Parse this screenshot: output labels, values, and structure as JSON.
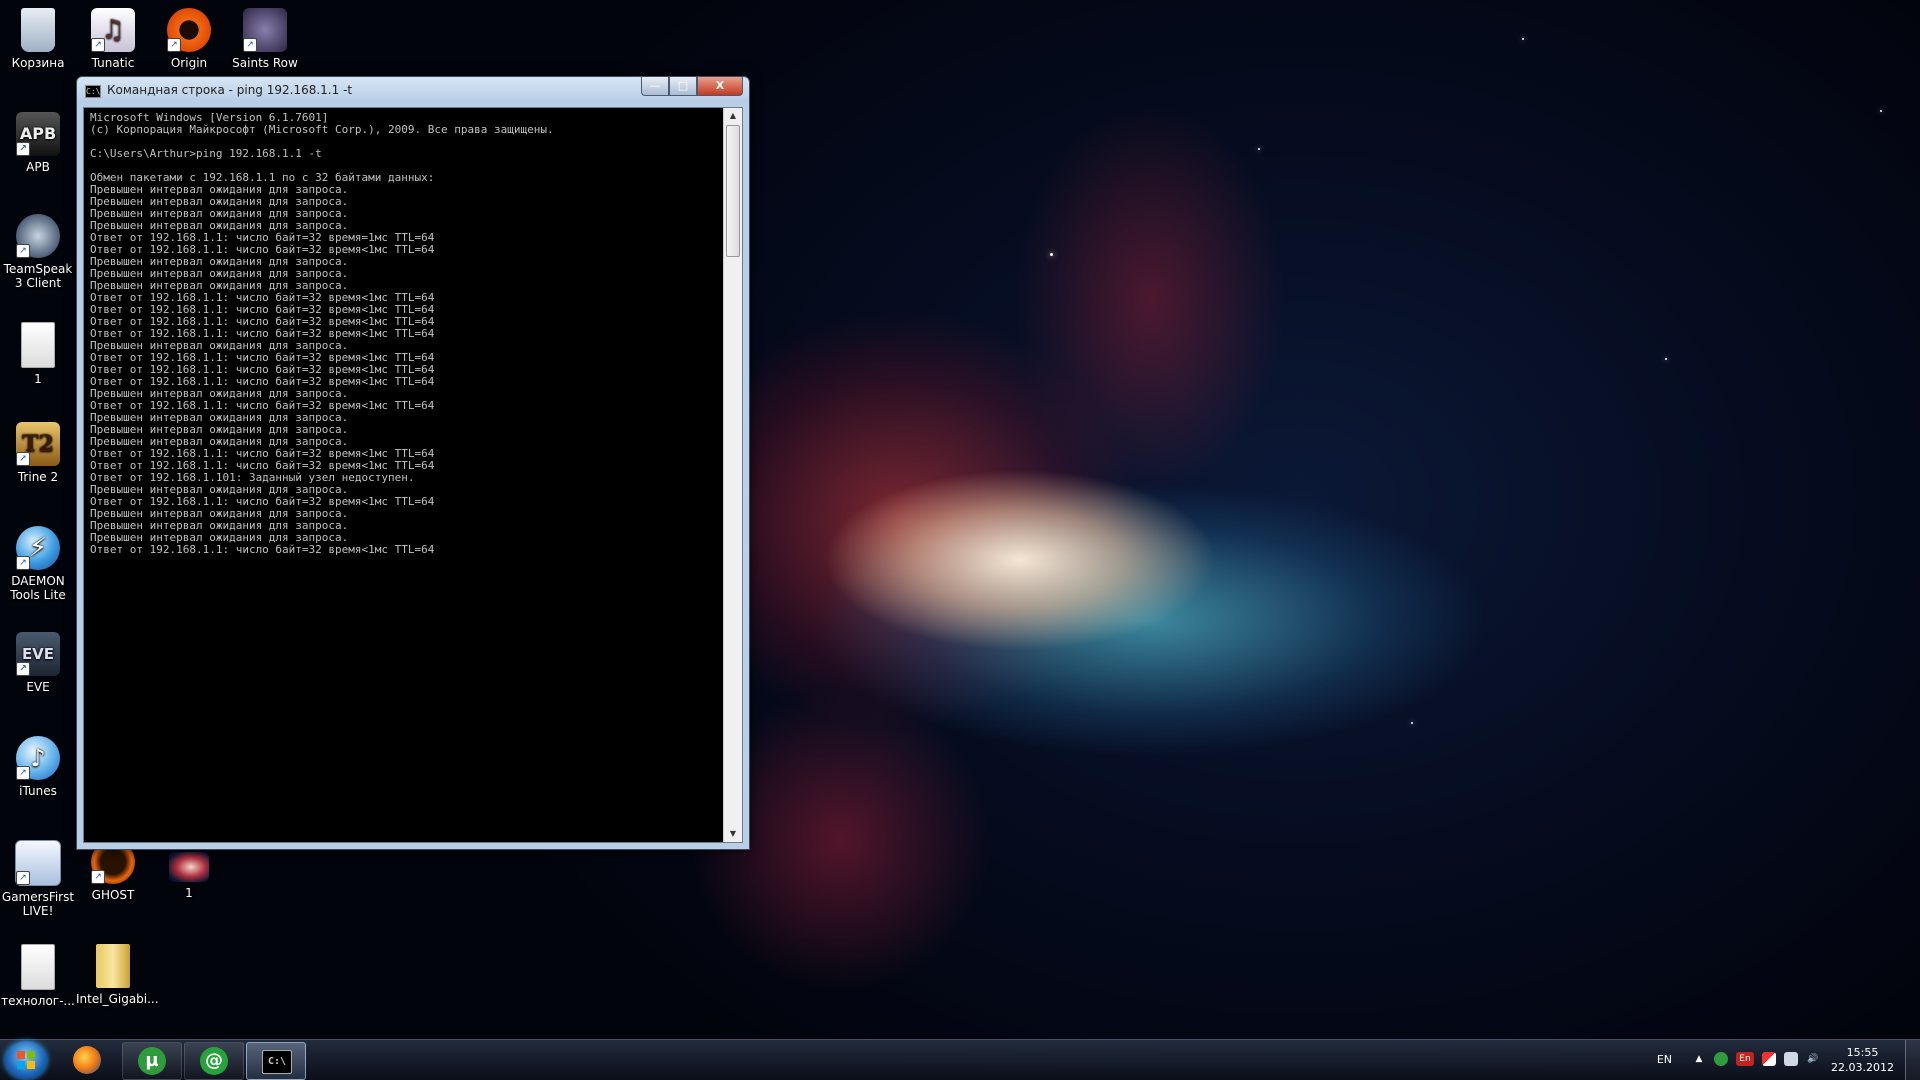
{
  "desktop": {
    "icons": [
      {
        "label": "Корзина",
        "icon": "recycle-bin-icon"
      },
      {
        "label": "Tunatic",
        "icon": "tunatic-icon"
      },
      {
        "label": "Origin",
        "icon": "origin-icon"
      },
      {
        "label": "Saints Row",
        "icon": "saints-row-icon"
      },
      {
        "label": "APB",
        "icon": "apb-icon"
      },
      {
        "label": "TeamSpeak 3 Client",
        "icon": "teamspeak-icon"
      },
      {
        "label": "1",
        "icon": "text-file-icon"
      },
      {
        "label": "Trine 2",
        "icon": "trine-icon"
      },
      {
        "label": "DAEMON Tools Lite",
        "icon": "daemon-tools-icon"
      },
      {
        "label": "EVE",
        "icon": "eve-icon"
      },
      {
        "label": "iTunes",
        "icon": "itunes-icon"
      },
      {
        "label": "GamersFirst LIVE!",
        "icon": "gamersfirst-icon"
      },
      {
        "label": "GHOST",
        "icon": "ghost-icon"
      },
      {
        "label": "1",
        "icon": "image-file-icon"
      },
      {
        "label": "технолог-...",
        "icon": "text-file-icon"
      },
      {
        "label": "Intel_Gigabi...",
        "icon": "zip-folder-icon"
      }
    ]
  },
  "window": {
    "title": "Командная строка - ping  192.168.1.1 -t",
    "controls": {
      "minimize": "—",
      "maximize": "□",
      "close": "X"
    },
    "console_lines": [
      "Microsoft Windows [Version 6.1.7601]",
      "(c) Корпорация Майкрософт (Microsoft Corp.), 2009. Все права защищены.",
      "",
      "C:\\Users\\Arthur>ping 192.168.1.1 -t",
      "",
      "Обмен пакетами с 192.168.1.1 по с 32 байтами данных:",
      "Превышен интервал ожидания для запроса.",
      "Превышен интервал ожидания для запроса.",
      "Превышен интервал ожидания для запроса.",
      "Превышен интервал ожидания для запроса.",
      "Ответ от 192.168.1.1: число байт=32 время=1мс TTL=64",
      "Ответ от 192.168.1.1: число байт=32 время<1мс TTL=64",
      "Превышен интервал ожидания для запроса.",
      "Превышен интервал ожидания для запроса.",
      "Превышен интервал ожидания для запроса.",
      "Ответ от 192.168.1.1: число байт=32 время<1мс TTL=64",
      "Ответ от 192.168.1.1: число байт=32 время<1мс TTL=64",
      "Ответ от 192.168.1.1: число байт=32 время<1мс TTL=64",
      "Ответ от 192.168.1.1: число байт=32 время<1мс TTL=64",
      "Превышен интервал ожидания для запроса.",
      "Ответ от 192.168.1.1: число байт=32 время<1мс TTL=64",
      "Ответ от 192.168.1.1: число байт=32 время<1мс TTL=64",
      "Ответ от 192.168.1.1: число байт=32 время<1мс TTL=64",
      "Превышен интервал ожидания для запроса.",
      "Ответ от 192.168.1.1: число байт=32 время<1мс TTL=64",
      "Превышен интервал ожидания для запроса.",
      "Превышен интервал ожидания для запроса.",
      "Превышен интервал ожидания для запроса.",
      "Ответ от 192.168.1.1: число байт=32 время<1мс TTL=64",
      "Ответ от 192.168.1.1: число байт=32 время<1мс TTL=64",
      "Ответ от 192.168.1.101: Заданный узел недоступен.",
      "Превышен интервал ожидания для запроса.",
      "Ответ от 192.168.1.1: число байт=32 время<1мс TTL=64",
      "Превышен интервал ожидания для запроса.",
      "Превышен интервал ожидания для запроса.",
      "Превышен интервал ожидания для запроса.",
      "Ответ от 192.168.1.1: число байт=32 время<1мс TTL=64"
    ]
  },
  "taskbar": {
    "buttons": [
      {
        "name": "firefox",
        "icon": "firefox-icon"
      },
      {
        "name": "utorrent",
        "icon": "utorrent-icon",
        "glyph": "µ"
      },
      {
        "name": "mail-agent",
        "icon": "mail-agent-icon",
        "glyph": "@"
      },
      {
        "name": "cmd",
        "icon": "cmd-icon",
        "glyph": "C:\\"
      }
    ],
    "tray": {
      "language": "EN",
      "lang_indicator": "En",
      "time": "15:55",
      "date": "22.03.2012"
    }
  },
  "colors": {
    "console_bg": "#000000",
    "console_text": "#c0c0c0",
    "close_button": "#c13a20",
    "titlebar": "#c6d9ee"
  }
}
